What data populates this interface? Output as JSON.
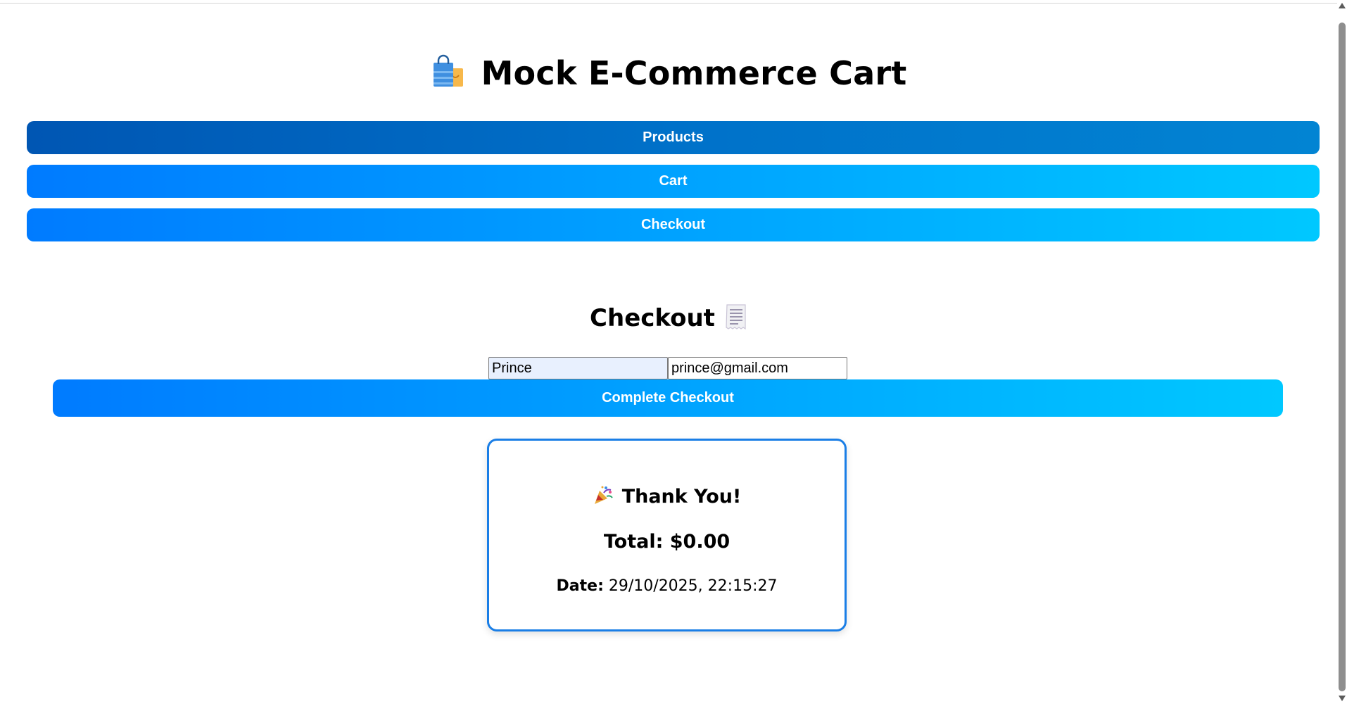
{
  "app": {
    "title": "Mock E-Commerce Cart",
    "title_icon": "shopping-bags-icon"
  },
  "nav": {
    "products_label": "Products",
    "cart_label": "Cart",
    "checkout_label": "Checkout"
  },
  "checkout": {
    "heading": "Checkout",
    "heading_icon": "receipt-icon",
    "name_value": "Prince",
    "email_value": "prince@gmail.com",
    "complete_label": "Complete Checkout"
  },
  "receipt": {
    "thank_you": "Thank You!",
    "thank_you_icon": "party-popper-icon",
    "total_label": "Total: $0.00",
    "date_label": "Date:",
    "date_value": "29/10/2025, 22:15:27"
  },
  "colors": {
    "gradient_start": "#007bff",
    "gradient_end": "#00c8ff",
    "active_start": "#0056b3",
    "card_border": "#1a7ee6"
  }
}
